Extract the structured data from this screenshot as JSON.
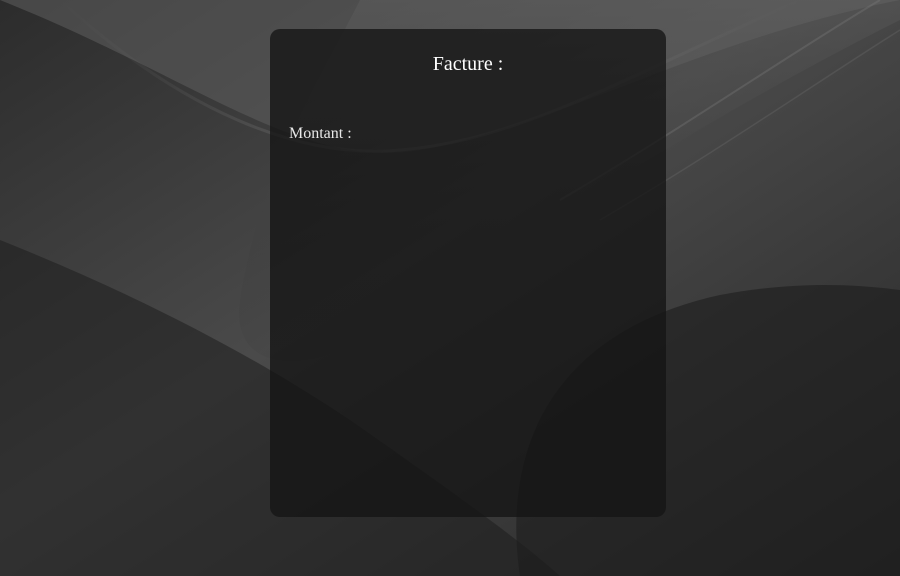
{
  "invoice": {
    "title": "Facture :",
    "amount_label": "Montant :"
  },
  "colors": {
    "background": "#3a3a3a",
    "panel": "#1e1e1e",
    "text": "#ffffff"
  }
}
